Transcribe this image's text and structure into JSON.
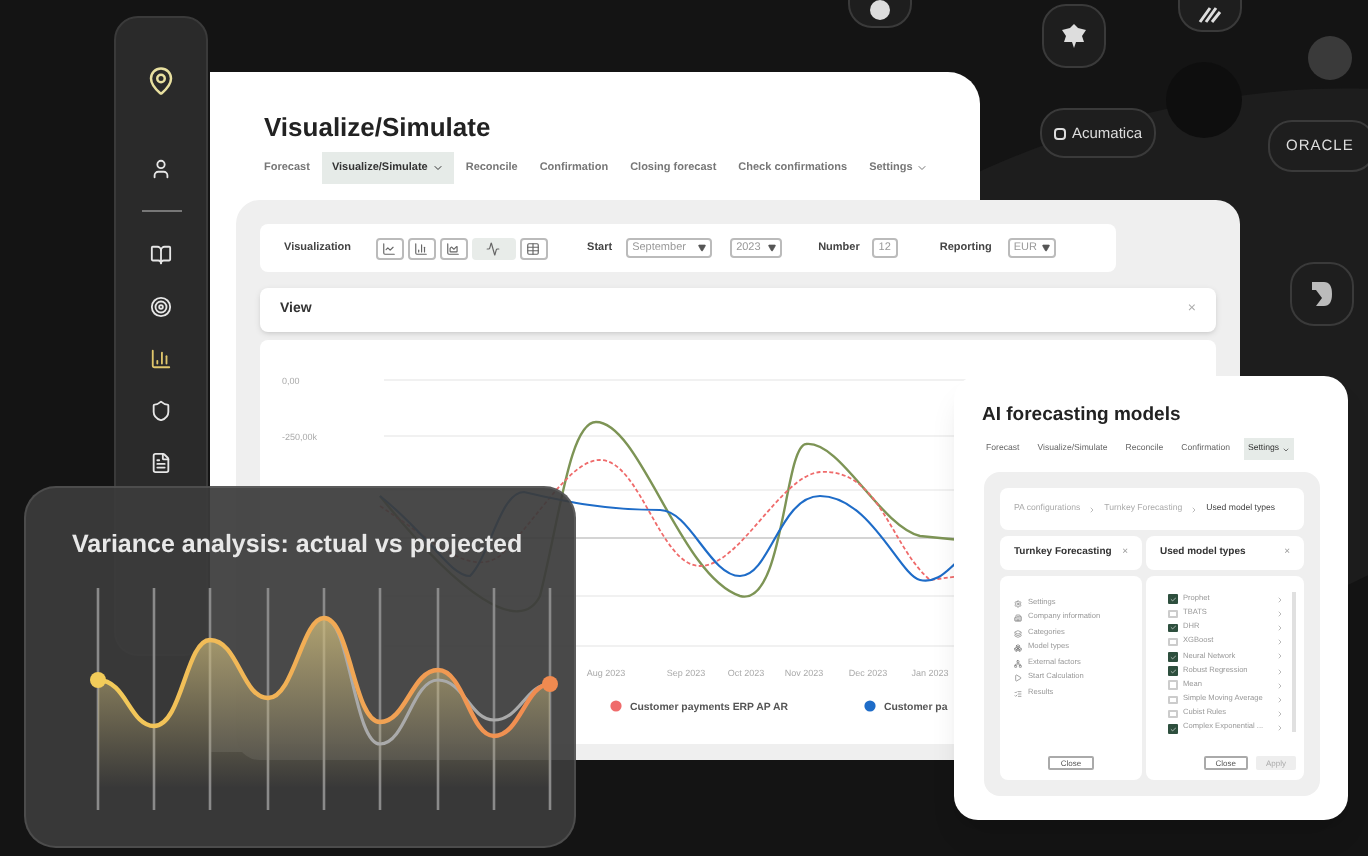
{
  "integration_badges": [
    {
      "label": "Acumatica"
    },
    {
      "label": "ORACLE"
    }
  ],
  "sidebar": {
    "items": [
      {
        "selected": false
      },
      {
        "selected": false
      },
      {
        "selected": false
      },
      {
        "selected": true
      },
      {
        "selected": false
      },
      {
        "selected": false
      }
    ]
  },
  "main_window": {
    "title": "Visualize/Simulate",
    "tabs": [
      {
        "label": "Forecast",
        "selected": false,
        "dropdown": false
      },
      {
        "label": "Visualize/Simulate",
        "selected": true,
        "dropdown": true
      },
      {
        "label": "Reconcile",
        "selected": false,
        "dropdown": false
      },
      {
        "label": "Confirmation",
        "selected": false,
        "dropdown": false
      },
      {
        "label": "Closing forecast",
        "selected": false,
        "dropdown": false
      },
      {
        "label": "Check confirmations",
        "selected": false,
        "dropdown": false
      },
      {
        "label": "Settings",
        "selected": false,
        "dropdown": true
      }
    ]
  },
  "toolbar": {
    "visualization_label": "Visualization",
    "chart_types": [
      {
        "selected": false
      },
      {
        "selected": false
      },
      {
        "selected": false
      },
      {
        "selected": true
      },
      {
        "selected": false
      }
    ],
    "start_label": "Start",
    "month": "September",
    "year": "2023",
    "number_label": "Number",
    "number": "12",
    "reporting_label": "Reporting",
    "currency": "EUR"
  },
  "view_panel": {
    "title": "View",
    "close": "×"
  },
  "chart": {
    "y_tick_labels": [
      "0,00",
      "-250,00k"
    ],
    "x_labels": [
      "Aug 2023",
      "Sep 2023",
      "Oct 2023",
      "Nov 2023",
      "Dec 2023",
      "Jan 2023"
    ],
    "legend": [
      {
        "label": "Customer payments ERP AP AR",
        "color": "#ef6b6b"
      },
      {
        "label": "Customer pa",
        "color": "#1e6cc8"
      }
    ]
  },
  "variance_card": {
    "title": "Variance analysis: actual vs projected"
  },
  "ai_window": {
    "title": "AI forecasting models",
    "tabs": [
      {
        "label": "Forecast",
        "selected": false,
        "dropdown": false
      },
      {
        "label": "Visualize/Simulate",
        "selected": false,
        "dropdown": false
      },
      {
        "label": "Reconcile",
        "selected": false,
        "dropdown": false
      },
      {
        "label": "Confirmation",
        "selected": false,
        "dropdown": false
      },
      {
        "label": "Settings",
        "selected": true,
        "dropdown": true
      }
    ],
    "breadcrumb": [
      "PA configurations",
      "Turnkey Forecasting",
      "Used model types"
    ],
    "left_panel": {
      "title": "Turnkey Forecasting",
      "close": "×",
      "items": [
        "Settings",
        "Company information",
        "Categories",
        "Model types",
        "External factors",
        "Start Calculation",
        "Results"
      ],
      "button": "Close"
    },
    "right_panel": {
      "title": "Used model types",
      "close": "×",
      "items": [
        {
          "label": "Prophet",
          "checked": true
        },
        {
          "label": "TBATS",
          "checked": false
        },
        {
          "label": "DHR",
          "checked": true
        },
        {
          "label": "XGBoost",
          "checked": false
        },
        {
          "label": "Neural Network",
          "checked": true
        },
        {
          "label": "Robust Regression",
          "checked": true
        },
        {
          "label": "Mean",
          "checked": false
        },
        {
          "label": "Simple Moving Average",
          "checked": false
        },
        {
          "label": "Cubist Rules",
          "checked": false
        },
        {
          "label": "Complex Exponential ...",
          "checked": true
        }
      ],
      "buttons": [
        {
          "label": "Close",
          "disabled": false
        },
        {
          "label": "Apply",
          "disabled": true
        }
      ]
    }
  }
}
